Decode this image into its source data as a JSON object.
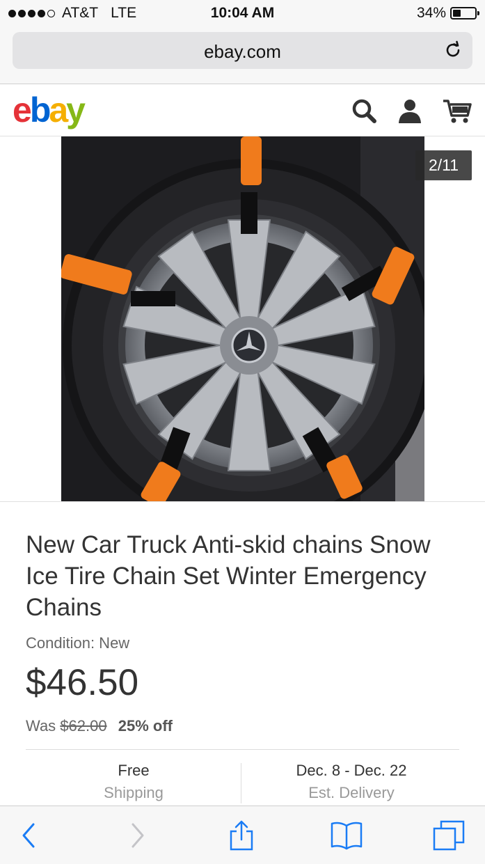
{
  "status_bar": {
    "carrier": "AT&T",
    "network": "LTE",
    "time": "10:04 AM",
    "battery": "34%",
    "battery_level": 0.34
  },
  "browser": {
    "url": "ebay.com",
    "reload_icon": "reload-icon"
  },
  "header": {
    "logo_letters": [
      "e",
      "b",
      "a",
      "y"
    ],
    "logo_colors": [
      "#e53238",
      "#0064d2",
      "#f5af02",
      "#86b817"
    ],
    "icons": [
      "search-icon",
      "user-icon",
      "cart-icon"
    ]
  },
  "gallery": {
    "counter": "2/11",
    "current": 2,
    "total": 11
  },
  "product": {
    "title": "New Car Truck Anti-skid chains Snow Ice Tire Chain Set Winter Emergency Chains",
    "condition": "Condition: New",
    "price": "$46.50",
    "was_label": "Was",
    "was_price": "$62.00",
    "discount": "25% off"
  },
  "shipping": {
    "line1": "Free",
    "line2": "Shipping"
  },
  "delivery": {
    "line1": "Dec. 8 - Dec. 22",
    "line2": "Est. Delivery"
  },
  "toolbar": {
    "icons": [
      "back-icon",
      "forward-icon",
      "share-icon",
      "bookmarks-icon",
      "tabs-icon"
    ],
    "accent": "#1a7cf5"
  }
}
